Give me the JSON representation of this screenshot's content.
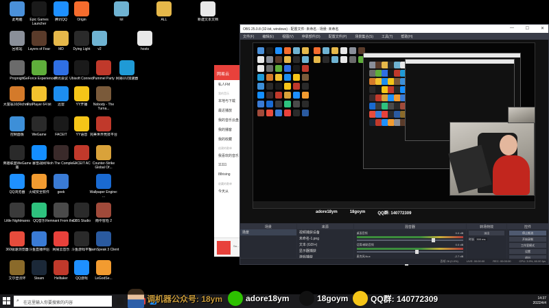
{
  "colors": {
    "accent_red": "#e8413b",
    "obs_bg": "#2b2e38",
    "taskbar": "#1c1c1f",
    "desktop": "#000000"
  },
  "desktop_icons": [
    {
      "label": "此电脑",
      "color": "#4a90d9",
      "icon": "computer-icon"
    },
    {
      "label": "Epic Games Launcher",
      "color": "#1a1a1a",
      "icon": "epic-icon"
    },
    {
      "label": "腾讯QQ",
      "color": "#1e90ff",
      "icon": "qq-icon"
    },
    {
      "label": "Origin",
      "color": "#f56c2d",
      "icon": "origin-icon"
    },
    {
      "label": "lol",
      "color": "#6fb3d2",
      "icon": "file-icon"
    },
    {
      "label": "ALL",
      "color": "#e6b84a",
      "icon": "folder-icon"
    },
    {
      "label": "新建文本文档",
      "color": "#e8e8e8",
      "icon": "document-icon"
    },
    {
      "label": "回收站",
      "color": "#8a8f99",
      "icon": "recycle-bin-icon"
    },
    {
      "label": "Layers of Fear",
      "color": "#5a3b2a",
      "icon": "game-icon"
    },
    {
      "label": "MD",
      "color": "#e6b84a",
      "icon": "folder-icon"
    },
    {
      "label": "Dying Light",
      "color": "#2a2a2a",
      "icon": "game-icon"
    },
    {
      "label": "v2",
      "color": "#6fb3d2",
      "icon": "file-icon"
    },
    {
      "label": "hosts",
      "color": "#e8e8e8",
      "icon": "document-icon"
    },
    {
      "label": "Propnight",
      "color": "#6b6b6b",
      "icon": "game-icon"
    },
    {
      "label": "GeForce Experience",
      "color": "#5fae3b",
      "icon": "nvidia-icon"
    },
    {
      "label": "腾讯会议",
      "color": "#2f6fe4",
      "icon": "meeting-icon"
    },
    {
      "label": "Ubisoft Connect",
      "color": "#1a1a1a",
      "icon": "ubisoft-icon"
    },
    {
      "label": "Pummel Party",
      "color": "#c0392b",
      "icon": "game-icon"
    },
    {
      "label": "网易UU加速器",
      "color": "#1f9ad6",
      "icon": "uu-icon"
    },
    {
      "label": "大富翁10(Richm...",
      "color": "#d47a2a",
      "icon": "game-icon"
    },
    {
      "label": "PotPlayer 64 bit",
      "color": "#f2c12e",
      "icon": "potplayer-icon"
    },
    {
      "label": "迅雷",
      "color": "#1d8ef0",
      "icon": "thunder-icon"
    },
    {
      "label": "YY开播",
      "color": "#f5c518",
      "icon": "yy-icon"
    },
    {
      "label": "Nobody - The Turna...",
      "color": "#7a5a3a",
      "icon": "game-icon"
    },
    {
      "label": "控制面板",
      "color": "#3d8fd8",
      "icon": "control-panel-icon"
    },
    {
      "label": "WeGame",
      "color": "#2a2a2a",
      "icon": "wegame-icon"
    },
    {
      "label": "FACEIT",
      "color": "#1a1a1a",
      "icon": "faceit-icon"
    },
    {
      "label": "YY语音",
      "color": "#f5c518",
      "icon": "yy-icon"
    },
    {
      "label": "完美世界竞技平台",
      "color": "#c0392b",
      "icon": "perfect-world-icon"
    },
    {
      "label": "英雄联盟WeGame版",
      "color": "#2a2a2a",
      "icon": "lol-icon"
    },
    {
      "label": "暴雪战网",
      "color": "#148eff",
      "icon": "battlenet-icon"
    },
    {
      "label": "Nioh The Comple...",
      "color": "#3a2a2a",
      "icon": "game-icon"
    },
    {
      "label": "FACEIT AC",
      "color": "#c0392b",
      "icon": "faceit-icon"
    },
    {
      "label": "Counter-Strike Global Of...",
      "color": "#d9a23a",
      "icon": "csgo-icon"
    },
    {
      "label": "QQ浏览器",
      "color": "#1e90ff",
      "icon": "browser-icon"
    },
    {
      "label": "火绒安全软件",
      "color": "#f29b30",
      "icon": "shield-icon"
    },
    {
      "label": "geek",
      "color": "#3a7bd5",
      "icon": "geek-icon"
    },
    {
      "label": "Wallpaper Engine: ...",
      "color": "#1a6ad1",
      "icon": "wallpaper-icon"
    },
    {
      "label": "Little Nightmares",
      "color": "#3a3a3a",
      "icon": "game-icon"
    },
    {
      "label": "QQ音乐",
      "color": "#2ec27e",
      "icon": "music-icon"
    },
    {
      "label": "Remnant From the...",
      "color": "#4a4a4a",
      "icon": "game-icon"
    },
    {
      "label": "OBS Studio",
      "color": "#2a2a2a",
      "icon": "obs-icon"
    },
    {
      "label": "雨中冒险 2",
      "color": "#a04a3a",
      "icon": "game-icon"
    },
    {
      "label": "360极速浏览器",
      "color": "#e74c3c",
      "icon": "browser-icon"
    },
    {
      "label": "斗鱼直播伴侣",
      "color": "#3a7bd5",
      "icon": "douyu-icon"
    },
    {
      "label": "网易云音乐",
      "color": "#e8413b",
      "icon": "netease-music-icon"
    },
    {
      "label": "斗鱼游戏平台",
      "color": "#2a2a2a",
      "icon": "game-platform-icon"
    },
    {
      "label": "TeamSpeak 3 Client",
      "color": "#2a5aa0",
      "icon": "teamspeak-icon"
    },
    {
      "label": "艾尔登法环",
      "color": "#8a6a2a",
      "icon": "game-icon"
    },
    {
      "label": "Steam",
      "color": "#1b2838",
      "icon": "steam-icon"
    },
    {
      "label": "Helltaker",
      "color": "#c0392b",
      "icon": "game-icon"
    },
    {
      "label": "QQ游戏",
      "color": "#1e90ff",
      "icon": "qq-game-icon"
    },
    {
      "label": "LeGodSe...",
      "color": "#f29b30",
      "icon": "game-icon"
    }
  ],
  "music_window": {
    "title": "网易云",
    "items": [
      "私人FM",
      "我的音乐",
      "本地与下载",
      "最近播放",
      "我的音乐云盘",
      "我的播客",
      "我的收藏",
      "创建的歌单",
      "我喜欢的音乐",
      "11111",
      "88rising",
      "收藏的歌单",
      "今天从"
    ],
    "section_items": [
      1,
      7,
      11
    ],
    "foot_text": "Sa..."
  },
  "obs": {
    "title": "OBS 25.0.8 (32-bit, windows) - 配置文件: 未命名 - 场景: 未命名",
    "menu": [
      "文件(F)",
      "编辑(E)",
      "视图(V)",
      "停靠部件(D)",
      "配置文件(P)",
      "场景集合(S)",
      "工具(T)",
      "帮助(H)"
    ],
    "docks": {
      "scenes": {
        "title": "场景",
        "items": [
          "场景"
        ]
      },
      "sources": {
        "title": "来源",
        "items": [
          "视频捕获设备",
          "未命名-1.png",
          "文本 (GDI+)",
          "显示器捕获",
          "游戏捕获"
        ]
      },
      "mixer": {
        "title": "混音器",
        "tracks": [
          {
            "name": "桌面音频",
            "db": "0.0 dB",
            "level": 0.7
          },
          {
            "name": "话筒/辅助音频",
            "db": "0.0 dB",
            "level": 0.55
          },
          {
            "name": "麦克风/Aux",
            "db": "-2.7 dB",
            "level": 0.45
          }
        ]
      },
      "transitions": {
        "title": "转场特效",
        "type": "淡出",
        "duration_label": "时长",
        "duration": "300 ms"
      },
      "controls": {
        "title": "控件",
        "buttons": [
          "停止推流",
          "开始录制",
          "工作室模式",
          "设置",
          "退出"
        ]
      }
    },
    "status": {
      "live": "LIVE: 00:00:00",
      "rec": "REC: 00:00:00",
      "cpu": "CPU: 3.9%, 60.00 fps",
      "dropped": "丢帧 26 (0.0%)"
    }
  },
  "stream_overlay": {
    "items": [
      {
        "text": "调机器公众号: 18ym",
        "icon": "avatar-figure",
        "color": "#c89a3a"
      },
      {
        "text": "adore18ym",
        "icon": "wechat-icon",
        "color": "#2dc100"
      },
      {
        "text": "18goym",
        "icon": "tiktok-icon",
        "color": "#111111"
      },
      {
        "text": "QQ群: 140772309",
        "icon": "qq-penguin-icon",
        "color": "#f5c518"
      }
    ],
    "mini_items": [
      "adore18ym",
      "18goym",
      "QQ群: 140772309"
    ]
  },
  "taskbar": {
    "search_placeholder": "在这里输入你要搜索的内容",
    "time": "14:37",
    "date": "2022/4/4",
    "icons": [
      {
        "name": "obs-taskbar-icon",
        "color": "#1a1a1a"
      },
      {
        "name": "explorer-taskbar-icon",
        "color": "#e6b84a"
      },
      {
        "name": "netease-taskbar-icon",
        "color": "#e8413b"
      },
      {
        "name": "browser-taskbar-icon",
        "color": "#1e90ff"
      }
    ]
  }
}
